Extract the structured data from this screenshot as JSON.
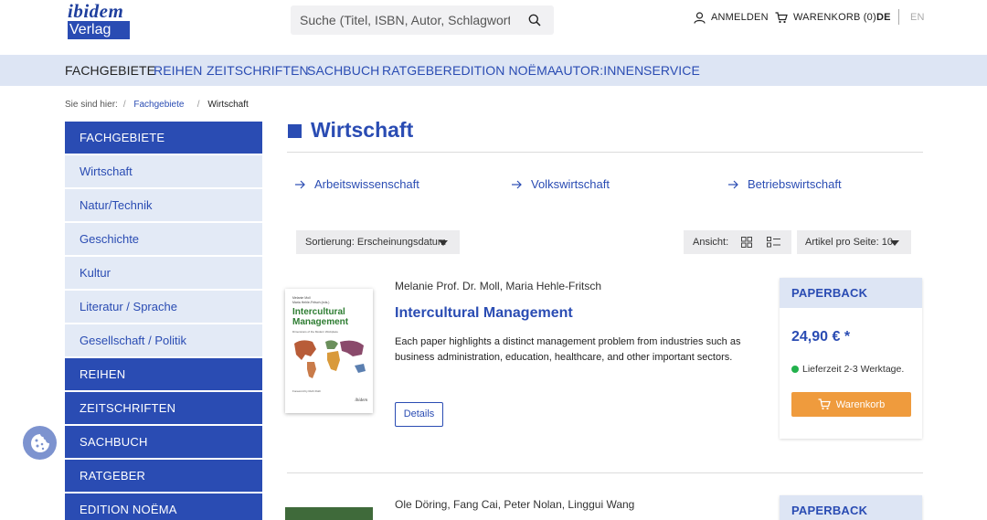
{
  "header": {
    "logo_line1": "ibidem",
    "logo_line2": "Verlag",
    "search_placeholder": "Suche (Titel, ISBN, Autor, Schlagwort)",
    "login_label": "ANMELDEN",
    "cart_label": "WARENKORB (0)",
    "lang_de": "DE",
    "lang_en": "EN"
  },
  "nav": [
    "FACHGEBIETE",
    "REIHEN",
    "ZEITSCHRIFTEN",
    "SACHBUCH",
    "RATGEBER",
    "EDITION NOËMA",
    "AUTOR:INNEN",
    "SERVICE"
  ],
  "breadcrumb": {
    "prefix": "Sie sind hier:",
    "link": "Fachgebiete",
    "current": "Wirtschaft"
  },
  "sidebar": [
    {
      "label": "FACHGEBIETE",
      "style": "dark"
    },
    {
      "label": "Wirtschaft",
      "style": "light"
    },
    {
      "label": "Natur/Technik",
      "style": "light"
    },
    {
      "label": "Geschichte",
      "style": "light"
    },
    {
      "label": "Kultur",
      "style": "light"
    },
    {
      "label": "Literatur / Sprache",
      "style": "light"
    },
    {
      "label": "Gesellschaft / Politik",
      "style": "light"
    },
    {
      "label": "REIHEN",
      "style": "dark"
    },
    {
      "label": "ZEITSCHRIFTEN",
      "style": "dark"
    },
    {
      "label": "SACHBUCH",
      "style": "dark"
    },
    {
      "label": "RATGEBER",
      "style": "dark"
    },
    {
      "label": "EDITION NOËMA",
      "style": "dark"
    }
  ],
  "content": {
    "title": "Wirtschaft",
    "subcategories": [
      "Arbeitswissenschaft",
      "Volkswirtschaft",
      "Betriebswirtschaft"
    ],
    "sort_label": "Sortierung: Erscheinungsdatum",
    "view_label": "Ansicht:",
    "per_page_label": "Artikel pro Seite: 10"
  },
  "products": [
    {
      "authors": "Melanie Prof. Dr. Moll, Maria Hehle-Fritsch",
      "title": "Intercultural Management",
      "description": "Each paper highlights a distinct management problem from industries such as business administration, education, healthcare, and other important sectors.",
      "details_label": "Details",
      "format": "PAPERBACK",
      "price": "24,90 € *",
      "delivery": "Lieferzeit 2-3 Werktage.",
      "cart_button": "Warenkorb",
      "cover": {
        "authors": "Melanie Moll\nMaria Hehle-Fritsch (eds.)",
        "title": "Intercultural Management",
        "subtitle": "Dimensions of the Modern Workplace",
        "foreword": "Foreword by Ruth Roth",
        "publisher": "ibidem"
      }
    },
    {
      "authors": "Ole Döring, Fang Cai, Peter Nolan, Linggui Wang",
      "format": "PAPERBACK"
    }
  ],
  "colors": {
    "brand_blue": "#2a4cb3",
    "nav_bg": "#dde5f4",
    "cart_orange": "#ef9b3d",
    "stock_green": "#22b14c"
  }
}
